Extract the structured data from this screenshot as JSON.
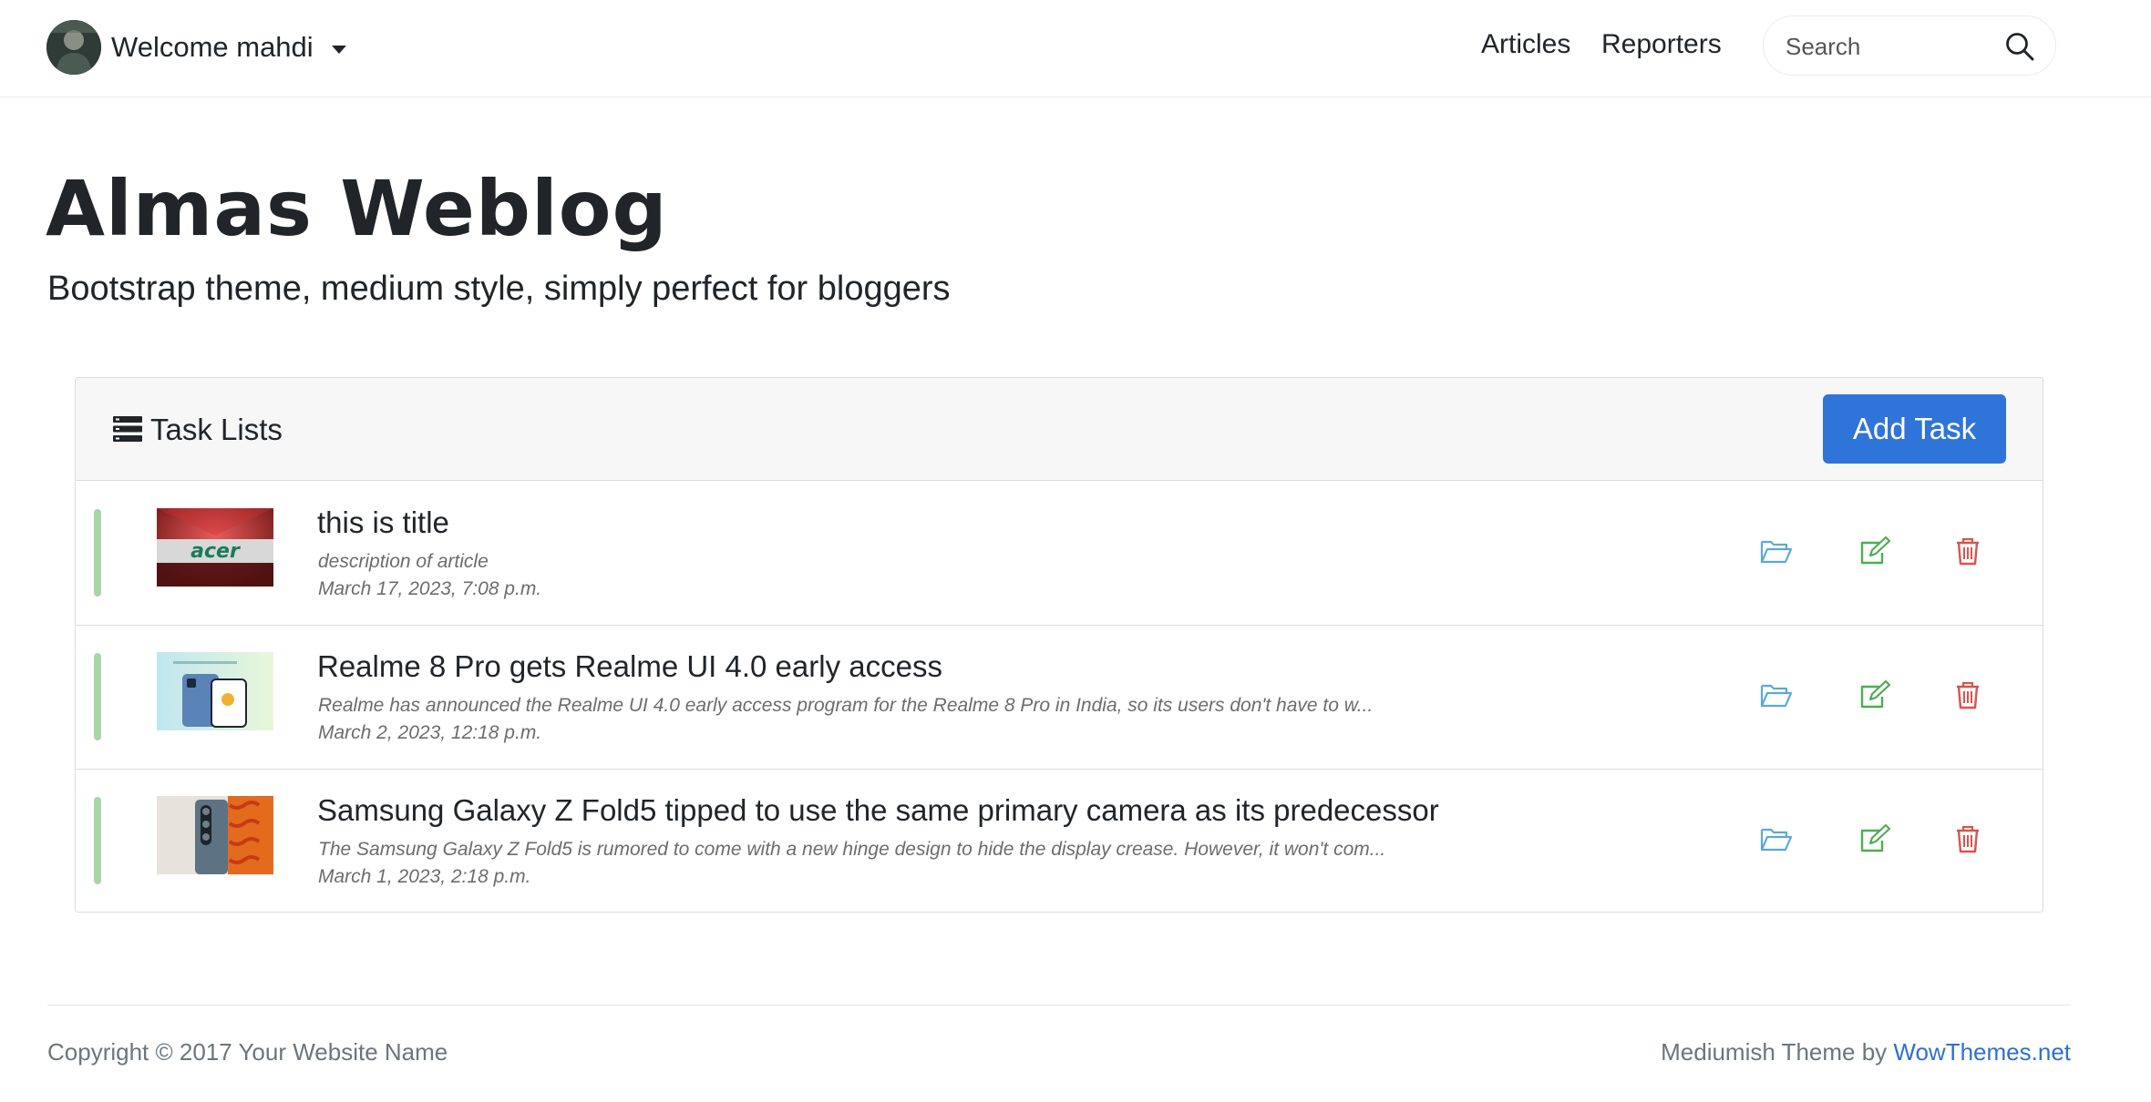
{
  "navbar": {
    "user_label": "Welcome mahdi",
    "links": [
      "Articles",
      "Reporters"
    ],
    "search_placeholder": "Search"
  },
  "header": {
    "title": "Almas Weblog",
    "tagline": "Bootstrap theme, medium style, simply perfect for bloggers"
  },
  "tasks": {
    "title": "Task Lists",
    "add_label": "Add Task",
    "items": [
      {
        "title": "this is title",
        "description": "description of article",
        "date": "March 17, 2023, 7:08 p.m."
      },
      {
        "title": "Realme 8 Pro gets Realme UI 4.0 early access",
        "description": "Realme has announced the Realme UI 4.0 early access program for the Realme 8 Pro in India, so its users don't have to w...",
        "date": "March 2, 2023, 12:18 p.m."
      },
      {
        "title": "Samsung Galaxy Z Fold5 tipped to use the same primary camera as its predecessor",
        "description": "The Samsung Galaxy Z Fold5 is rumored to come with a new hinge design to hide the display crease. However, it won't com...",
        "date": "March 1, 2023, 2:18 p.m."
      }
    ]
  },
  "footer": {
    "copyright": "Copyright © 2017 Your Website Name",
    "credit_prefix": "Mediumish Theme by ",
    "credit_link": "WowThemes.net"
  },
  "colors": {
    "accent": "#2f74d9",
    "open_icon": "#5aa9d6",
    "edit_icon": "#4caf50",
    "delete_icon": "#d9534f",
    "row_bar": "#a8d5a8"
  },
  "icons": [
    "avatar",
    "caret-down-icon",
    "search-icon",
    "list-icon",
    "folder-open-icon",
    "edit-icon",
    "trash-icon"
  ]
}
